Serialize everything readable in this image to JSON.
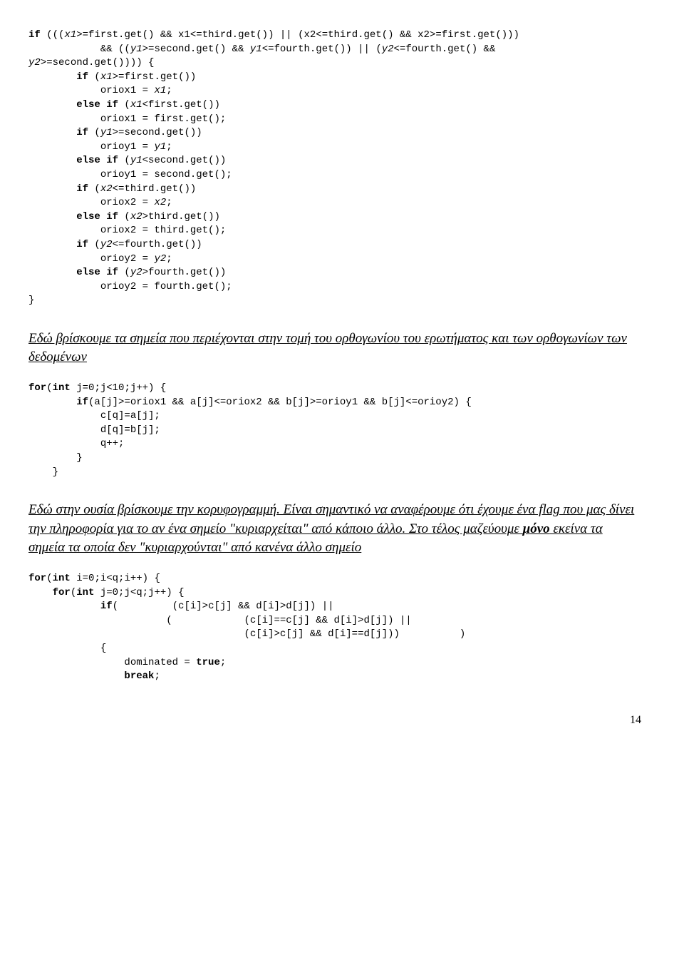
{
  "code1": "if (((x1>=first.get() && x1<=third.get()) || (x2<=third.get() && x2>=first.get()))\n            && ((y1>=second.get() && y1<=fourth.get()) || (y2<=fourth.get() &&\ny2>=second.get()))) {\n        if (x1>=first.get())\n            oriox1 = x1;\n        else if (x1<first.get())\n            oriox1 = first.get();\n        if (y1>=second.get())\n            orioy1 = y1;\n        else if (y1<second.get())\n            orioy1 = second.get();\n        if (x2<=third.get())\n            oriox2 = x2;\n        else if (x2>third.get())\n            oriox2 = third.get();\n        if (y2<=fourth.get())\n            orioy2 = y2;\n        else if (y2>fourth.get())\n            orioy2 = fourth.get();\n}",
  "para1": "Εδώ βρίσκουμε τα σημεία που περιέχονται στην τομή του ορθογωνίου του ερωτήματος και των ορθογωνίων των δεδομένων",
  "code2": "for(int j=0;j<10;j++) {\n        if(a[j]>=oriox1 && a[j]<=oriox2 && b[j]>=orioy1 && b[j]<=orioy2) {\n            c[q]=a[j];\n            d[q]=b[j];\n            q++;\n        }\n    }",
  "para2_a": "Εδώ στην ουσία βρίσκουμε την κορυφογραμμή. Είναι σημαντικό να αναφέρουμε ότι έχουμε ένα flag που μας δίνει την πληροφορία για το αν ένα σημείο \"κυριαρχείται\" από κάποιο άλλο. Στο τέλος μαζεύουμε ",
  "para2_b": "μόνο",
  "para2_c": " εκείνα τα σημεία τα οποία δεν \"κυριαρχούνται\" από κανένα άλλο σημείο",
  "code3": "for(int i=0;i<q;i++) {\n    for(int j=0;j<q;j++) {\n            if(         (c[i]>c[j] && d[i]>d[j]) ||\n                       (            (c[i]==c[j] && d[i]>d[j]) ||\n                                    (c[i]>c[j] && d[i]==d[j]))          )\n            {\n                dominated = true;\n                break;",
  "pagenum": "14"
}
